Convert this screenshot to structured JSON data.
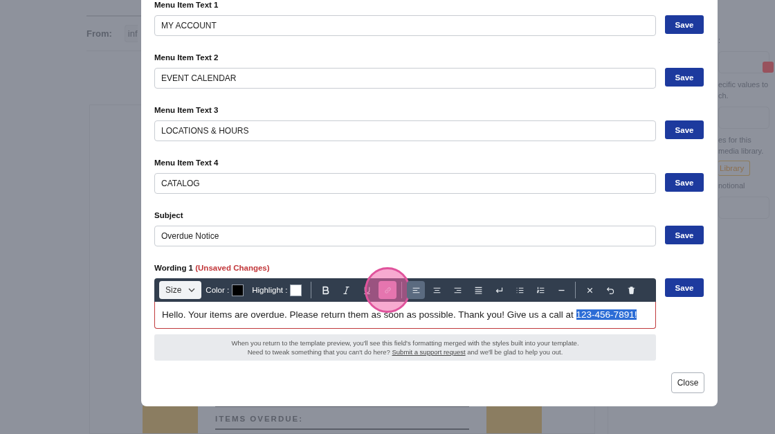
{
  "background": {
    "from_label": "From:",
    "from_value": "inf",
    "side_texts": [
      {
        "kind": "text",
        "text": ":"
      },
      {
        "kind": "select"
      },
      {
        "kind": "text",
        "text": "ecific values to"
      },
      {
        "kind": "text",
        "text": "ch."
      },
      {
        "kind": "select"
      },
      {
        "kind": "text",
        "text": "es for this"
      },
      {
        "kind": "text",
        "text": "media library."
      },
      {
        "kind": "button",
        "text": "Library"
      },
      {
        "kind": "text",
        "text": "notional"
      },
      {
        "kind": "date"
      }
    ],
    "poster_heading": "ITEMS OVERDUE:"
  },
  "modal": {
    "fields": [
      {
        "label": "Menu Item Text 1",
        "value": "MY ACCOUNT",
        "save": "Save"
      },
      {
        "label": "Menu Item Text 2",
        "value": "EVENT CALENDAR",
        "save": "Save"
      },
      {
        "label": "Menu Item Text 3",
        "value": "LOCATIONS & HOURS",
        "save": "Save"
      },
      {
        "label": "Menu Item Text 4",
        "value": "CATALOG",
        "save": "Save"
      },
      {
        "label": "Subject",
        "value": "Overdue Notice",
        "save": "Save"
      }
    ],
    "wording": {
      "label": "Wording 1",
      "status": "(Unsaved Changes)",
      "unsaved": true,
      "save": "Save",
      "size": "Size",
      "swatches": [
        {
          "label": "Color :",
          "color": "#000000"
        },
        {
          "label": "Highlight :",
          "color": "#ffffff"
        }
      ],
      "tools": [
        {
          "kind": "bold",
          "selected": false
        },
        {
          "kind": "italic",
          "selected": false
        },
        {
          "kind": "underline",
          "selected": false
        },
        {
          "kind": "link",
          "selected": false,
          "pressed": true
        },
        {
          "kind": "sep"
        },
        {
          "kind": "align-left",
          "selected": true
        },
        {
          "kind": "align-center",
          "selected": false
        },
        {
          "kind": "align-right",
          "selected": false
        },
        {
          "kind": "justify",
          "selected": false
        },
        {
          "kind": "line-break",
          "selected": false
        },
        {
          "kind": "bullets",
          "selected": false
        },
        {
          "kind": "numbers",
          "selected": false
        },
        {
          "kind": "rule",
          "selected": false
        },
        {
          "kind": "sep"
        },
        {
          "kind": "clear",
          "selected": false
        },
        {
          "kind": "undo",
          "selected": false
        },
        {
          "kind": "delete",
          "selected": false
        }
      ],
      "text": "Hello. Your items are overdue. Please return them as soon as possible. Thank you! Give us a call at ",
      "selection": "123-456-7891!"
    },
    "notice": {
      "line1": "When you return to the template preview, you'll see this field's formatting merged with the styles built into your template.",
      "line2_before": "Need to tweak something that you can't do here? ",
      "link": "Submit a support request",
      "line2_after": " and we'll be glad to help you out."
    },
    "close": "Close"
  }
}
